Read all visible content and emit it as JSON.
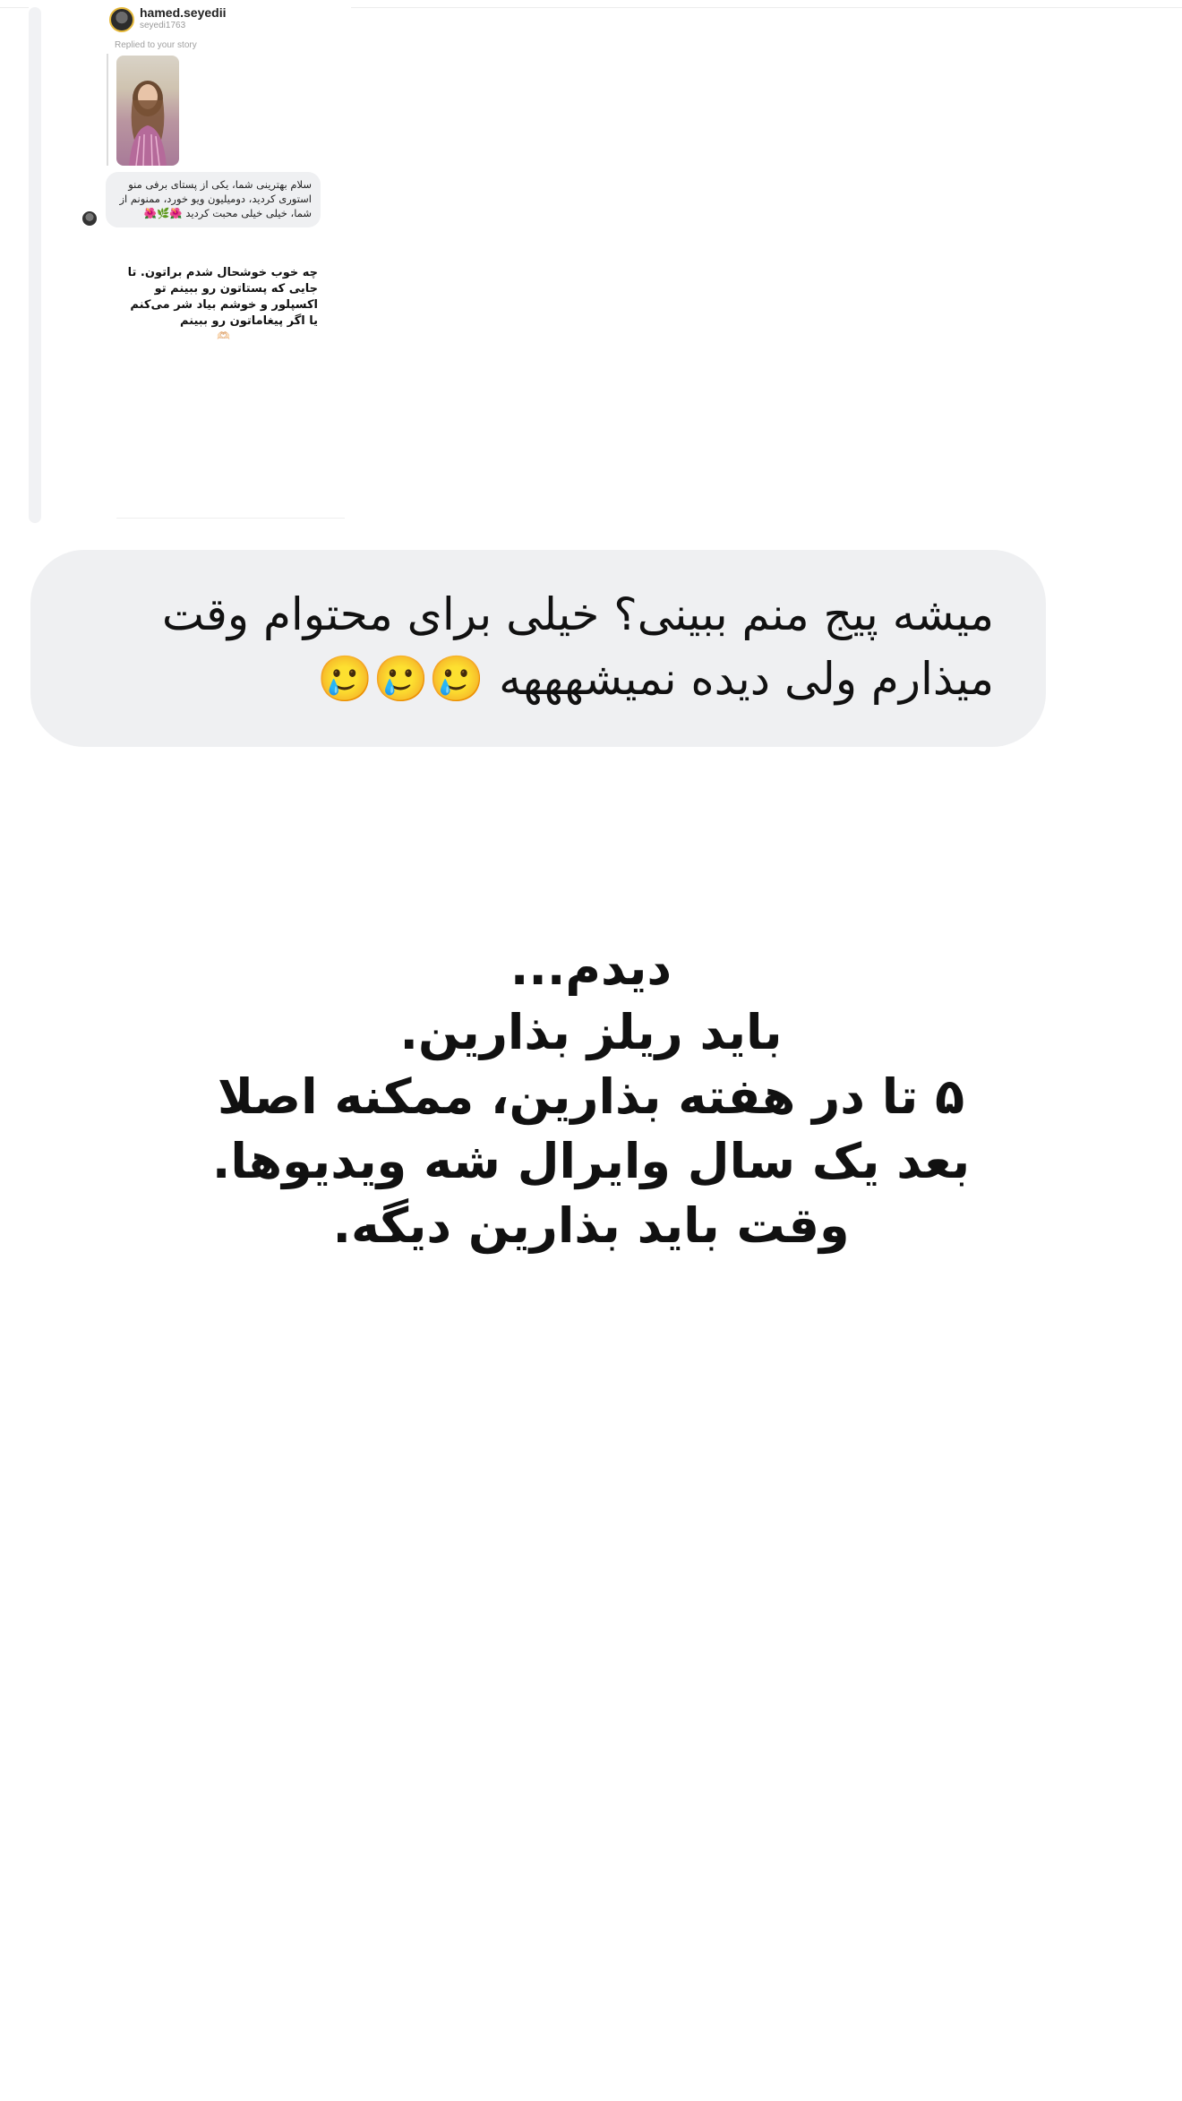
{
  "embedded_screenshot": {
    "profile_name": "hamed.seyedii",
    "profile_handle": "seyedi1763",
    "replied_label": "Replied to your story",
    "story_message": "سلام بهترینی شما، یکی از پستای برفی منو استوری کردید، دومیلیون ویو خورد، ممنونم از شما، خیلی خیلی محبت کردید 🌺🌿🌺",
    "reply_text": "چه خوب خوشحال شدم براتون. تا جایی که پستاتون رو ببینم تو اکسپلور و خوشم بیاد شر می‌کنم یا اگر پیغاماتون رو ببینم",
    "reply_emoji": "🫶🏻"
  },
  "message_bubble": {
    "text": "میشه پیج منم ببینی؟ خیلی برای محتوام وقت میذارم ولی دیده نمیشهههه 🥲🥲🥲"
  },
  "reply_caption": {
    "lines": [
      "دیدم...",
      "باید ریلز بذارین.",
      "۵ تا در هفته بذارین، ممکنه اصلا",
      "بعد یک سال وایرال شه ویدیوها.",
      "وقت باید بذارین دیگه."
    ]
  }
}
